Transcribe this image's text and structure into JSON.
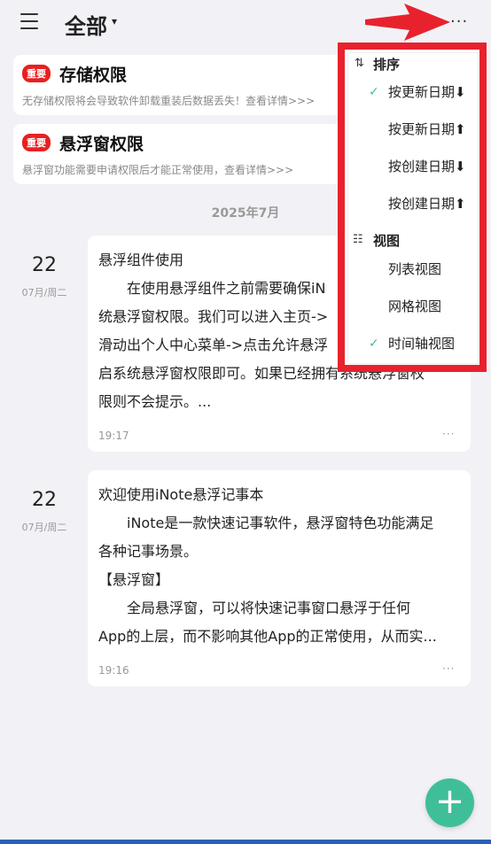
{
  "header": {
    "title": "全部",
    "caret": "▾",
    "more": "···"
  },
  "notices": [
    {
      "badge": "重要",
      "title": "存储权限",
      "desc": "无存储权限将会导致软件卸载重装后数据丢失！查看详情>>>"
    },
    {
      "badge": "重要",
      "title": "悬浮窗权限",
      "desc": "悬浮窗功能需要申请权限后才能正常使用，查看详情>>>"
    }
  ],
  "month": "2025年7月",
  "notes": [
    {
      "day": "22",
      "sub": "07月/周二",
      "title": "悬浮组件使用",
      "lines": [
        "　　在使用悬浮组件之前需要确保iN",
        "统悬浮窗权限。我们可以进入主页->",
        "滑动出个人中心菜单->点击允许悬浮",
        "启系统悬浮窗权限即可。如果已经拥有系统悬浮窗权",
        "限则不会提示。..."
      ],
      "time": "19:17",
      "more": "···"
    },
    {
      "day": "22",
      "sub": "07月/周二",
      "title": "欢迎使用iNote悬浮记事本",
      "lines": [
        "　　iNote是一款快速记事软件，悬浮窗特色功能满足",
        "各种记事场景。",
        "【悬浮窗】",
        "　　全局悬浮窗，可以将快速记事窗口悬浮于任何",
        "App的上层，而不影响其他App的正常使用，从而实..."
      ],
      "time": "19:16",
      "more": "···"
    }
  ],
  "dropdown": {
    "sort_title": "排序",
    "sort_icon": "⇅",
    "sort_items": [
      {
        "label": "按更新日期⬇",
        "checked": true
      },
      {
        "label": "按更新日期⬆",
        "checked": false
      },
      {
        "label": "按创建日期⬇",
        "checked": false
      },
      {
        "label": "按创建日期⬆",
        "checked": false
      }
    ],
    "view_title": "视图",
    "view_icon": "☷",
    "view_items": [
      {
        "label": "列表视图",
        "checked": false
      },
      {
        "label": "网格视图",
        "checked": false
      },
      {
        "label": "时间轴视图",
        "checked": true
      }
    ],
    "check_mark": "✓"
  },
  "fab": {
    "label": "+"
  },
  "colors": {
    "accent": "#3fbf99",
    "badge": "#e82020",
    "highlight": "#e8222d"
  }
}
